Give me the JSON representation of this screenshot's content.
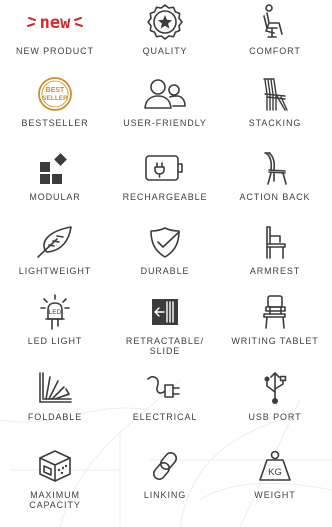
{
  "features": [
    {
      "icon": "new-badge-icon",
      "label": "NEW PRODUCT"
    },
    {
      "icon": "quality-star-icon",
      "label": "QUALITY"
    },
    {
      "icon": "comfort-seat-icon",
      "label": "COMFORT"
    },
    {
      "icon": "bestseller-badge-icon",
      "label": "BESTSELLER"
    },
    {
      "icon": "users-icon",
      "label": "USER-FRIENDLY"
    },
    {
      "icon": "stacked-chairs-icon",
      "label": "STACKING"
    },
    {
      "icon": "modular-blocks-icon",
      "label": "MODULAR"
    },
    {
      "icon": "battery-plug-icon",
      "label": "RECHARGEABLE"
    },
    {
      "icon": "action-back-chair-icon",
      "label": "ACTION BACK"
    },
    {
      "icon": "feather-icon",
      "label": "LIGHTWEIGHT"
    },
    {
      "icon": "shield-check-icon",
      "label": "DURABLE"
    },
    {
      "icon": "armrest-chair-icon",
      "label": "ARMREST"
    },
    {
      "icon": "led-bulb-icon",
      "label": "LED LIGHT"
    },
    {
      "icon": "retractable-slide-icon",
      "label": "RETRACTABLE/\nSLIDE"
    },
    {
      "icon": "writing-tablet-chair-icon",
      "label": "WRITING TABLET"
    },
    {
      "icon": "foldable-angle-icon",
      "label": "FOLDABLE"
    },
    {
      "icon": "electrical-plug-icon",
      "label": "ELECTRICAL"
    },
    {
      "icon": "usb-icon",
      "label": "USB PORT"
    },
    {
      "icon": "capacity-box-icon",
      "label": "MAXIMUM\nCAPACITY"
    },
    {
      "icon": "chain-link-icon",
      "label": "LINKING"
    },
    {
      "icon": "weight-kg-icon",
      "label": "WEIGHT"
    }
  ],
  "badges": {
    "new_text": "new",
    "bestseller_line1": "BEST",
    "bestseller_line2": "SELLER",
    "led_text": "LED",
    "weight_text": "KG"
  },
  "colors": {
    "icon": "#3c3c3c",
    "label": "#3f3f3f",
    "new_red": "#d42a2a",
    "bestseller_gold": "#c8922a"
  }
}
